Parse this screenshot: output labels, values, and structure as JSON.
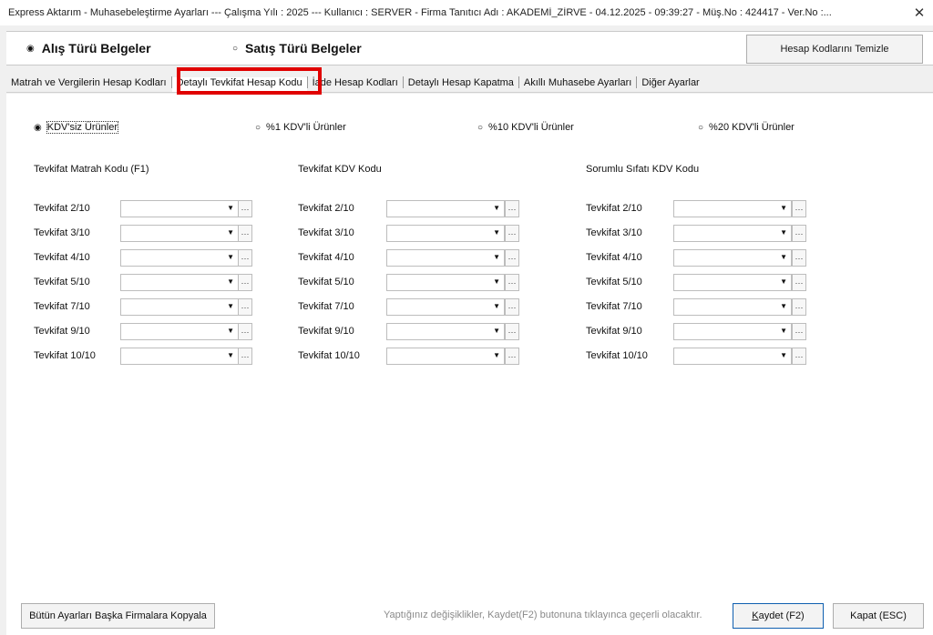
{
  "window": {
    "title": "Express Aktarım - Muhasebeleştirme Ayarları  ---  Çalışma Yılı : 2025  ---  Kullanıcı : SERVER - Firma Tanıtıcı Adı : AKADEMİ_ZİRVE - 04.12.2025 - 09:39:27 - Müş.No : 424417 - Ver.No :...",
    "close_glyph": "✕"
  },
  "doc_type": {
    "options": [
      {
        "label": "Alış Türü Belgeler",
        "selected": true
      },
      {
        "label": "Satış Türü Belgeler",
        "selected": false
      }
    ],
    "clear_button": "Hesap Kodlarını Temizle"
  },
  "tabs": [
    {
      "label": "Matrah ve Vergilerin Hesap Kodları",
      "active": false
    },
    {
      "label": "Detaylı Tevkifat Hesap Kodu",
      "active": true
    },
    {
      "label": "İade Hesap Kodları",
      "active": false
    },
    {
      "label": "Detaylı Hesap Kapatma",
      "active": false
    },
    {
      "label": "Akıllı Muhasebe Ayarları",
      "active": false
    },
    {
      "label": "Diğer Ayarlar",
      "active": false
    }
  ],
  "kdv_options": [
    {
      "label": "KDV'siz Ürünler",
      "selected": true
    },
    {
      "label": "%1 KDV'li Ürünler",
      "selected": false
    },
    {
      "label": "%10 KDV'li Ürünler",
      "selected": false
    },
    {
      "label": "%20 KDV'li Ürünler",
      "selected": false
    }
  ],
  "columns": [
    {
      "header": "Tevkifat Matrah Kodu (F1)"
    },
    {
      "header": "Tevkifat KDV Kodu"
    },
    {
      "header": "Sorumlu Sıfatı KDV Kodu"
    }
  ],
  "rows": [
    "Tevkifat 2/10",
    "Tevkifat 3/10",
    "Tevkifat 4/10",
    "Tevkifat 5/10",
    "Tevkifat 7/10",
    "Tevkifat 9/10",
    "Tevkifat 10/10"
  ],
  "field_values": "",
  "icons": {
    "dropdown": "chevron-down-icon",
    "browse": "ellipsis-icon",
    "radio_on": "◉",
    "radio_off": "○",
    "arrow": "▼",
    "dots": "···"
  },
  "footer": {
    "copy_button": "Bütün Ayarları Başka Firmalara Kopyala",
    "hint": "Yaptığınız değişiklikler, Kaydet(F2) butonuna tıklayınca geçerli olacaktır.",
    "save_button_k": "K",
    "save_button_rest": "aydet (F2)",
    "close_button": "Kapat (ESC)"
  },
  "colors": {
    "highlight_border": "#e00000",
    "window_bg": "#f0f0f0",
    "panel_bg": "#ffffff"
  }
}
